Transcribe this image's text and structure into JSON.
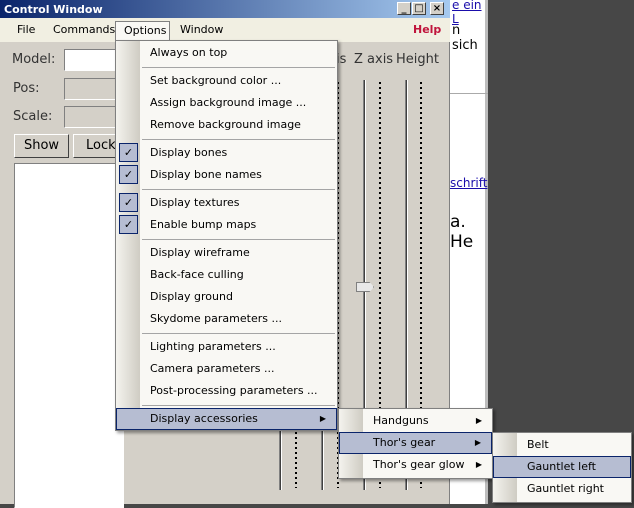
{
  "background_page": {
    "link1": "e ein L",
    "text1": "n sich",
    "link2": "schrift",
    "text2": "a. He"
  },
  "window": {
    "title": "Control Window",
    "minimize": "_",
    "maximize": "□",
    "close": "×"
  },
  "menubar": {
    "items": [
      "File",
      "Commands",
      "Options",
      "Window"
    ],
    "help": "Help",
    "active": "Options"
  },
  "form": {
    "model_label": "Model:",
    "model_value": "",
    "pos_label": "Pos:",
    "scale_label": "Scale:",
    "show_button": "Show",
    "lock_button": "Lock"
  },
  "sliders": {
    "z_axis_label": "Z axis",
    "height_label": "Height",
    "partial_label": "is"
  },
  "options_menu": {
    "items": [
      {
        "label": "Always on top",
        "checked": false
      },
      {
        "label": "Set background color ...",
        "checked": false
      },
      {
        "label": "Assign background image ...",
        "checked": false
      },
      {
        "label": "Remove background image",
        "checked": false
      },
      {
        "label": "Display bones",
        "checked": true
      },
      {
        "label": "Display bone names",
        "checked": true
      },
      {
        "label": "Display textures",
        "checked": true
      },
      {
        "label": "Enable bump maps",
        "checked": true
      },
      {
        "label": "Display wireframe",
        "checked": false
      },
      {
        "label": "Back-face culling",
        "checked": false
      },
      {
        "label": "Display ground",
        "checked": false
      },
      {
        "label": "Skydome parameters ...",
        "checked": false
      },
      {
        "label": "Lighting parameters ...",
        "checked": false
      },
      {
        "label": "Camera parameters ...",
        "checked": false
      },
      {
        "label": "Post-processing parameters ...",
        "checked": false
      },
      {
        "label": "Display accessories",
        "checked": false,
        "submenu": true,
        "highlighted": true
      }
    ],
    "check_glyph": "✓",
    "arrow_glyph": "▶"
  },
  "accessories_menu": {
    "items": [
      {
        "label": "Handguns",
        "submenu": true
      },
      {
        "label": "Thor's gear",
        "submenu": true,
        "highlighted": true
      },
      {
        "label": "Thor's gear glow",
        "submenu": true
      }
    ]
  },
  "thors_gear_menu": {
    "items": [
      {
        "label": "Belt"
      },
      {
        "label": "Gauntlet left",
        "highlighted": true
      },
      {
        "label": "Gauntlet right"
      }
    ]
  },
  "colors": {
    "highlight": "#b6bdd2",
    "help": "#c0143c",
    "title_start": "#0a246a",
    "title_end": "#a6caf0"
  }
}
